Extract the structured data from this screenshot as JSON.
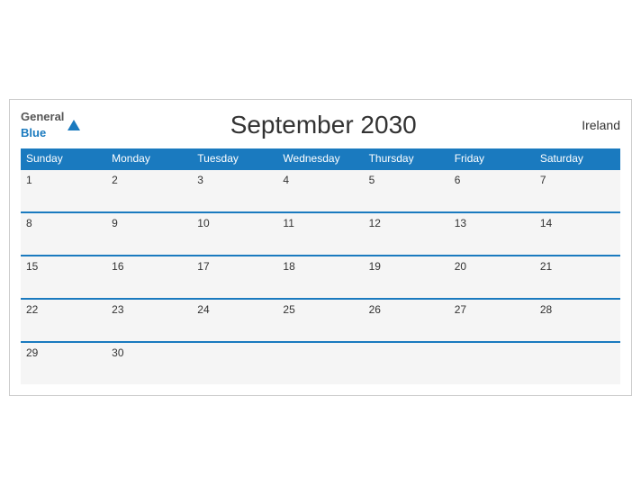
{
  "header": {
    "logo": {
      "general": "General",
      "blue": "Blue"
    },
    "title": "September 2030",
    "country": "Ireland"
  },
  "days_of_week": [
    "Sunday",
    "Monday",
    "Tuesday",
    "Wednesday",
    "Thursday",
    "Friday",
    "Saturday"
  ],
  "weeks": [
    [
      {
        "date": "1",
        "empty": false
      },
      {
        "date": "2",
        "empty": false
      },
      {
        "date": "3",
        "empty": false
      },
      {
        "date": "4",
        "empty": false
      },
      {
        "date": "5",
        "empty": false
      },
      {
        "date": "6",
        "empty": false
      },
      {
        "date": "7",
        "empty": false
      }
    ],
    [
      {
        "date": "8",
        "empty": false
      },
      {
        "date": "9",
        "empty": false
      },
      {
        "date": "10",
        "empty": false
      },
      {
        "date": "11",
        "empty": false
      },
      {
        "date": "12",
        "empty": false
      },
      {
        "date": "13",
        "empty": false
      },
      {
        "date": "14",
        "empty": false
      }
    ],
    [
      {
        "date": "15",
        "empty": false
      },
      {
        "date": "16",
        "empty": false
      },
      {
        "date": "17",
        "empty": false
      },
      {
        "date": "18",
        "empty": false
      },
      {
        "date": "19",
        "empty": false
      },
      {
        "date": "20",
        "empty": false
      },
      {
        "date": "21",
        "empty": false
      }
    ],
    [
      {
        "date": "22",
        "empty": false
      },
      {
        "date": "23",
        "empty": false
      },
      {
        "date": "24",
        "empty": false
      },
      {
        "date": "25",
        "empty": false
      },
      {
        "date": "26",
        "empty": false
      },
      {
        "date": "27",
        "empty": false
      },
      {
        "date": "28",
        "empty": false
      }
    ],
    [
      {
        "date": "29",
        "empty": false
      },
      {
        "date": "30",
        "empty": false
      },
      {
        "date": "",
        "empty": true
      },
      {
        "date": "",
        "empty": true
      },
      {
        "date": "",
        "empty": true
      },
      {
        "date": "",
        "empty": true
      },
      {
        "date": "",
        "empty": true
      }
    ]
  ]
}
